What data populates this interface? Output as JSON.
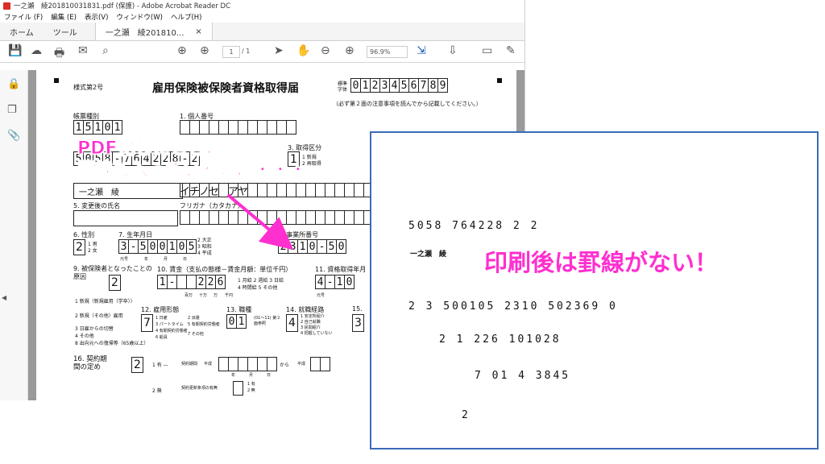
{
  "window": {
    "title": "一之瀬　綾201810031831.pdf (保護) - Adobe Acrobat Reader DC",
    "menu": [
      "ファイル (F)",
      "編集 (E)",
      "表示(V)",
      "ウィンドウ(W)",
      "ヘルプ(H)"
    ],
    "tabs": {
      "home": "ホーム",
      "tools": "ツール",
      "doc": "一之瀬　綾201810...",
      "close": "×"
    }
  },
  "toolbar": {
    "page_current": "1",
    "page_total": "/ 1",
    "zoom": "96.9%"
  },
  "form": {
    "form_no": "様式第2号",
    "title": "雇用保険被保険者資格取得届",
    "sample_label": "標準字体",
    "sample_digits": [
      "0",
      "1",
      "2",
      "3",
      "4",
      "5",
      "6",
      "7",
      "8",
      "9"
    ],
    "note": "（必ず第２面の注意事項を読んでから記載してください。）",
    "f_type": "帳票種別",
    "f_type_value": [
      "1",
      "5",
      "1",
      "0",
      "1"
    ],
    "f_1": "1. 個人番号",
    "f_3": "3. 取得区分",
    "f_3_opts": [
      "1 新規",
      "2 再取得"
    ],
    "f_3_value": "1",
    "row2_value": [
      "5",
      "0",
      "5",
      "8",
      "-",
      "7",
      "6",
      "4",
      "2",
      "2",
      "8",
      "-",
      "2"
    ],
    "name_value": "一之瀬　綾",
    "kana_value": [
      "イ",
      "チ",
      "ノ",
      "セ",
      "",
      "ア",
      "ヤ"
    ],
    "f_5": "5. 変更後の氏名",
    "f_kana": "フリガナ（カタカナ）",
    "f_6": "6. 性別",
    "f_6_value": "2",
    "f_6_opts": [
      "1 男",
      "2 女"
    ],
    "f_7": "7. 生年月日",
    "f_7_value": [
      "3",
      "-",
      "5",
      "0",
      "0",
      "1",
      "0",
      "5"
    ],
    "f_7_sub": [
      "元号",
      "年",
      "月",
      "日"
    ],
    "f_7_era": [
      "2 大正",
      "3 昭和",
      "4 平成"
    ],
    "f_8": "8. 事業所番号",
    "f_8_value": [
      "2",
      "3",
      "1",
      "0",
      "-",
      "5",
      "0"
    ],
    "f_9": "9. 被保険者となったことの原因",
    "f_9_value": "2",
    "f_9_opts": [
      "1 新規（新規雇用（学卒））",
      "2 新規（その他）雇用",
      "3 日雇からの切替",
      "4 その他",
      "8 出向元への復帰等（65歳以上）"
    ],
    "f_10": "10. 賃金（支払の態様－賃金月額：単位千円）",
    "f_10_value": [
      "1",
      "-",
      "",
      "",
      "2",
      "2",
      "6"
    ],
    "f_10_sub": [
      "百万",
      "十万",
      "万",
      "千円"
    ],
    "f_10_opts": [
      "1 月給 2 週給 3 日給",
      "4 時間給 5 その他"
    ],
    "f_11": "11. 資格取得年月",
    "f_11_value": [
      "4",
      "-",
      "1",
      "0"
    ],
    "f_11_sub": "元号",
    "f_12": "12. 雇用形態",
    "f_12_value": "7",
    "f_12_opts": [
      "1 日雇",
      "3 パートタイム",
      "4 有期契約労働者",
      "6 船員",
      "2 派遣",
      "5 有期契約労働者",
      "7 その他"
    ],
    "f_13": "13. 職種",
    "f_13_value": [
      "0",
      "1"
    ],
    "f_13_note": "(01〜11) 第２面参照",
    "f_14": "14. 就職経路",
    "f_14_value": "4",
    "f_14_opts": [
      "1 安定所紹介",
      "2 自己就職",
      "3 民間紹介",
      "4 把握していない"
    ],
    "f_15": "15.",
    "f_15_value": "3",
    "f_16": "16. 契約期間の定め",
    "f_16_value": "2",
    "f_16_opts": [
      "1 有 —",
      "2 無"
    ],
    "f_16_period": "契約期間",
    "f_16_era": "平成",
    "f_16_sub": [
      "年",
      "月",
      "日"
    ],
    "f_16_to": "から",
    "f_16_renew": "契約更新条項の有無",
    "f_16_renew_opts": [
      "1 有",
      "2 無"
    ]
  },
  "overlay": {
    "line1": "PDF化したときは",
    "line2": "罫線も入っているのに・・・"
  },
  "printout": {
    "rows": [
      "5058 764228 2  2",
      "2  3 500105  2310 502369 0",
      "2  1 226  101028",
      "7  01  4  3845",
      "2"
    ],
    "name": "一之瀬　綾",
    "message": "印刷後は罫線がない！"
  },
  "colors": {
    "accent": "#ff2fd0",
    "frame": "#3a6bb8",
    "acrobat_red": "#d92d27"
  }
}
